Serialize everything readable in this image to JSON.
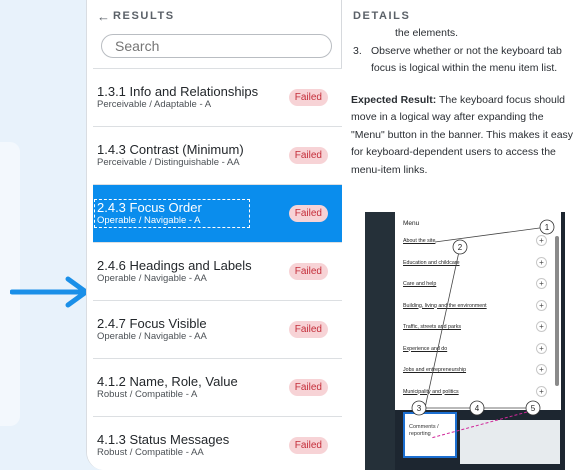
{
  "results": {
    "back_glyph": "←",
    "header": "RESULTS",
    "search_placeholder": "Search",
    "items": [
      {
        "title": "1.3.1 Info and Relationships",
        "sub": "Perceivable / Adaptable - A",
        "status": "Failed"
      },
      {
        "title": "1.4.3 Contrast (Minimum)",
        "sub": "Perceivable / Distinguishable - AA",
        "status": "Failed"
      },
      {
        "title": "2.4.3 Focus Order",
        "sub": "Operable / Navigable - A",
        "status": "Failed"
      },
      {
        "title": "2.4.6 Headings and Labels",
        "sub": "Operable / Navigable - AA",
        "status": "Failed"
      },
      {
        "title": "2.4.7 Focus Visible",
        "sub": "Operable / Navigable - AA",
        "status": "Failed"
      },
      {
        "title": "4.1.2 Name, Role, Value",
        "sub": "Robust / Compatible - A",
        "status": "Failed"
      },
      {
        "title": "4.1.3 Status Messages",
        "sub": "Robust / Compatible - AA",
        "status": "Failed"
      }
    ],
    "selected_index": 2
  },
  "details": {
    "header": "DETAILS",
    "step_cont": "the elements.",
    "step3_num": "3.",
    "step3_text": "Observe whether or not the keyboard tab focus is logical within the menu item list.",
    "expected_label": "Expected Result:",
    "expected_text": "The keyboard focus should move in a logical way after expanding the \"Menu\" button in the banner. This makes it easy for keyboard-dependent users to access the menu-item links."
  },
  "figure": {
    "menu_title": "Menu",
    "links": [
      "About the site",
      "Education and childcare",
      "Care and help",
      "Building, living and the environment",
      "Traffic, streets and parks",
      "Experience and do",
      "Jobs and entrepreneurship",
      "Municipality and politics"
    ],
    "markers": [
      "1",
      "2",
      "3",
      "4",
      "5"
    ],
    "focus_label": "Comments / reporting"
  },
  "colors": {
    "accent": "#0a8ded",
    "failed_bg": "#f7d3d6",
    "failed_text": "#c42e3a",
    "arrow": "#1a8fe8",
    "page_bg": "#e8f2fb"
  }
}
